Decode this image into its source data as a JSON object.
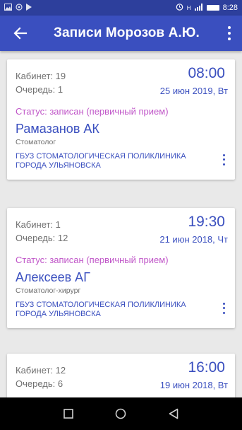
{
  "status_bar": {
    "time": "8:28",
    "left_icons": [
      "gallery-icon",
      "sync-icon",
      "play-icon"
    ],
    "right_icons": [
      "alarm-icon",
      "signal-icon",
      "battery-icon"
    ],
    "network": "H"
  },
  "app_bar": {
    "title": "Записи Морозов А.Ю.",
    "back_icon": "arrow-back-icon",
    "menu_icon": "more-vert-icon",
    "color": "#3a4fbf"
  },
  "appointments": [
    {
      "cabinet": "Кабинет: 19",
      "queue": "Очередь: 1",
      "time": "08:00",
      "date": "25 июн 2019, Вт",
      "status": "Статус: записан (первичный прием)",
      "doctor": "Рамазанов АК",
      "specialty": "Стоматолог",
      "clinic": "ГБУЗ СТОМАТОЛОГИЧЕСКАЯ ПОЛИКЛИНИКА ГОРОДА УЛЬЯНОВСКА"
    },
    {
      "cabinet": "Кабинет: 1",
      "queue": "Очередь: 12",
      "time": "19:30",
      "date": "21 июн 2018, Чт",
      "status": "Статус: записан (первичный прием)",
      "doctor": "Алексеев АГ",
      "specialty": "Стоматолог-хирург",
      "clinic": "ГБУЗ СТОМАТОЛОГИЧЕСКАЯ ПОЛИКЛИНИКА ГОРОДА УЛЬЯНОВСКА"
    },
    {
      "cabinet": "Кабинет: 12",
      "queue": "Очередь: 6",
      "time": "16:00",
      "date": "19 июн 2018, Вт"
    }
  ],
  "colors": {
    "accent": "#3a4fbf",
    "status": "#c056c8",
    "status_bar": "#2d3f9c",
    "muted_text": "#6f6f6f"
  },
  "nav_bar": {
    "icons": [
      "recent-apps-icon",
      "home-icon",
      "back-icon"
    ]
  }
}
